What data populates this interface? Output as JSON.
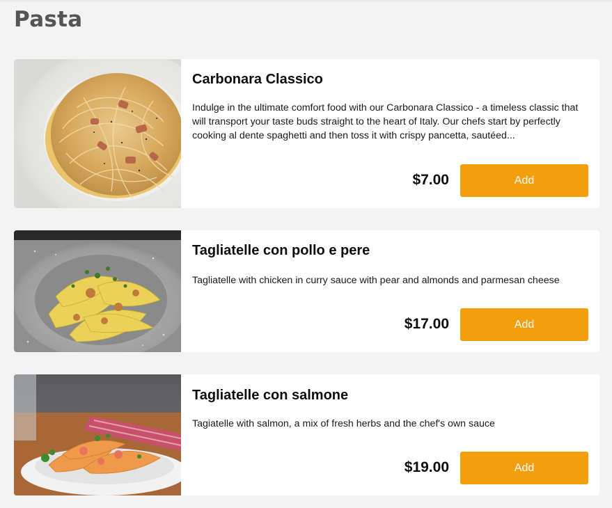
{
  "section": {
    "title": "Pasta"
  },
  "items": [
    {
      "name": "Carbonara Classico",
      "description": "Indulge in the ultimate comfort food with our Carbonara Classico - a timeless classic that will transport your taste buds straight to the heart of Italy. Our chefs start by perfectly cooking al dente spaghetti and then toss it with crispy pancetta, sautéed...",
      "price": "$7.00",
      "add_label": "Add",
      "image_icon": "spaghetti-carbonara-photo"
    },
    {
      "name": "Tagliatelle con pollo e pere",
      "description": "Tagliatelle with chicken in curry sauce with pear and almonds and parmesan cheese",
      "price": "$17.00",
      "add_label": "Add",
      "image_icon": "tagliatelle-chicken-photo"
    },
    {
      "name": "Tagliatelle con salmone",
      "description": "Tagiatelle with salmon, a mix of fresh herbs and the chef's own sauce",
      "price": "$19.00",
      "add_label": "Add",
      "image_icon": "tagliatelle-salmon-photo"
    }
  ],
  "colors": {
    "accent": "#f59e0b",
    "background": "#f3f3f3",
    "card": "#ffffff",
    "section_title": "#555555"
  }
}
